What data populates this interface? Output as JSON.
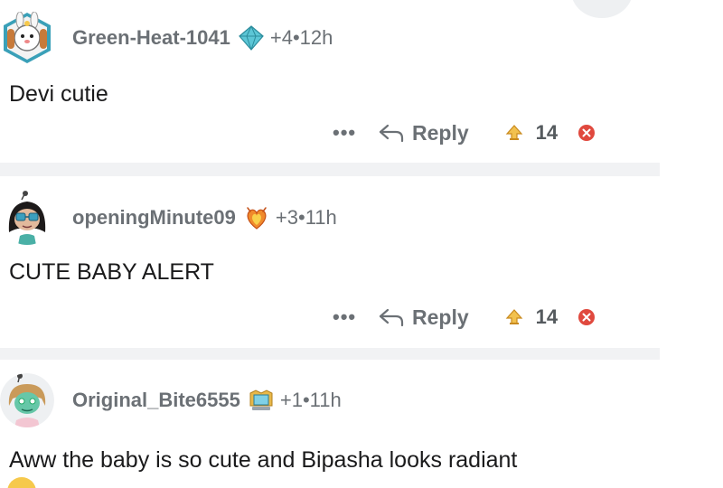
{
  "comments": [
    {
      "username": "Green-Heat-1041",
      "award_icon": "diamond-award-icon",
      "award_count": "+4",
      "separator": "•",
      "time": "12h",
      "text": "Devi cutie",
      "more_label": "•••",
      "reply_label": "Reply",
      "score": "14"
    },
    {
      "username": "openingMinute09",
      "award_icon": "flame-heart-award-icon",
      "award_count": "+3",
      "separator": "•",
      "time": "11h",
      "text": "CUTE BABY ALERT",
      "more_label": "•••",
      "reply_label": "Reply",
      "score": "14"
    },
    {
      "username": "Original_Bite6555",
      "award_icon": "laptop-award-icon",
      "award_count": "+1",
      "separator": "•",
      "time": "11h",
      "text": "Aww the baby is so cute and Bipasha looks radiant"
    }
  ],
  "colors": {
    "meta_gray": "#6b7075",
    "divider": "#f1f2f4",
    "upvote": "#e8a33a",
    "badge_red": "#e0493e"
  }
}
